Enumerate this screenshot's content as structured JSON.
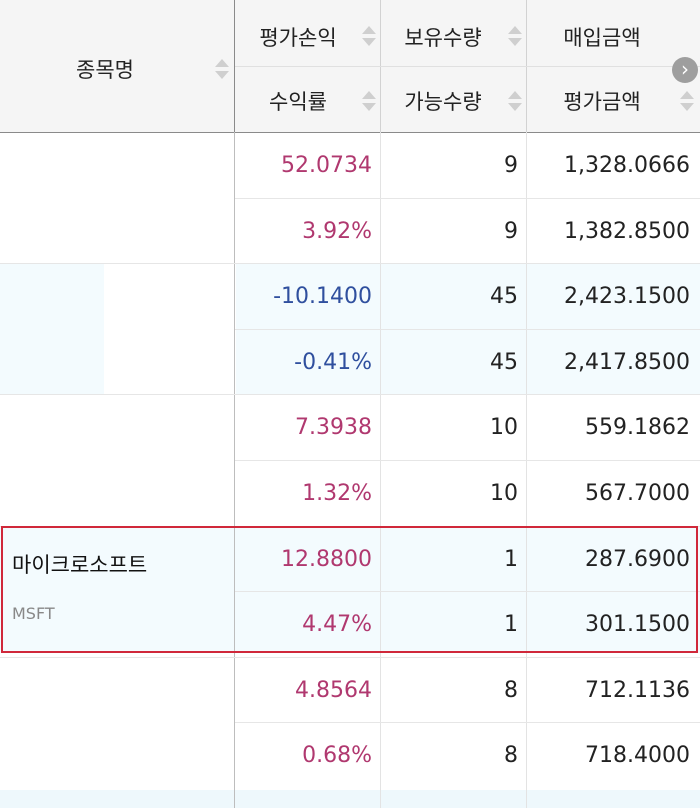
{
  "header": {
    "stock_name": "종목명",
    "eval_pl": "평가손익",
    "return_rate": "수익률",
    "holding_qty": "보유수량",
    "available_qty": "가능수량",
    "purchase_amount": "매입금액",
    "eval_amount": "평가금액"
  },
  "rows": [
    {
      "name": "",
      "ticker": "",
      "eval_pl": "52.0734",
      "return_rate": "3.92%",
      "holding_qty": "9",
      "available_qty": "9",
      "purchase_amount": "1,328.0666",
      "eval_amount": "1,382.8500"
    },
    {
      "name": "",
      "ticker": "",
      "eval_pl": "-10.1400",
      "return_rate": "-0.41%",
      "holding_qty": "45",
      "available_qty": "45",
      "purchase_amount": "2,423.1500",
      "eval_amount": "2,417.8500"
    },
    {
      "name": "",
      "ticker": "",
      "eval_pl": "7.3938",
      "return_rate": "1.32%",
      "holding_qty": "10",
      "available_qty": "10",
      "purchase_amount": "559.1862",
      "eval_amount": "567.7000"
    },
    {
      "name": "마이크로소프트",
      "ticker": "MSFT",
      "eval_pl": "12.8800",
      "return_rate": "4.47%",
      "holding_qty": "1",
      "available_qty": "1",
      "purchase_amount": "287.6900",
      "eval_amount": "301.1500"
    },
    {
      "name": "",
      "ticker": "",
      "eval_pl": "4.8564",
      "return_rate": "0.68%",
      "holding_qty": "8",
      "available_qty": "8",
      "purchase_amount": "712.1136",
      "eval_amount": "718.4000"
    }
  ],
  "colors": {
    "positive": "#b0386f",
    "negative": "#2f4f9e",
    "highlight_border": "#d0283a",
    "row_tint": "#f3fbfe"
  },
  "icons": {
    "sort": "sort-updown-icon",
    "scroll": "chevron-right-icon"
  }
}
